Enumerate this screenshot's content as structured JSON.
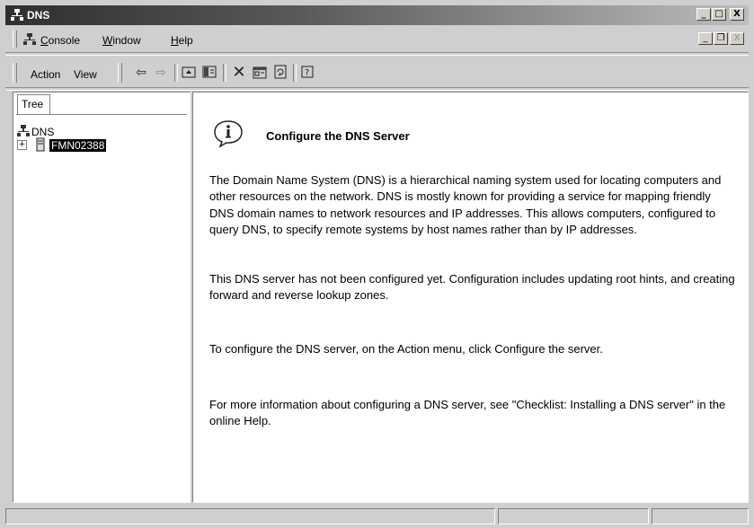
{
  "window": {
    "title": "DNS",
    "app_icon": "dns-tree-icon",
    "controls": {
      "minimize": "_",
      "maximize": "□",
      "close": "X"
    }
  },
  "menubar": {
    "items": [
      {
        "label": "Console",
        "underline": "C"
      },
      {
        "label": "Window",
        "underline": "W"
      },
      {
        "label": "Help",
        "underline": "H"
      }
    ],
    "mdi_controls": {
      "minimize": "_",
      "restore": "❐",
      "close": "X"
    }
  },
  "toolbar": {
    "action_label": "Action",
    "view_label": "View",
    "icons": [
      "back-arrow-icon",
      "forward-arrow-icon",
      "up-level-icon",
      "show-hide-tree-icon",
      "delete-icon",
      "properties-icon",
      "refresh-icon",
      "help-icon"
    ]
  },
  "tree": {
    "tab_label": "Tree",
    "root_label": "DNS",
    "server_label": "FMN02388",
    "expander": "+"
  },
  "content": {
    "title": "Configure the DNS Server",
    "paragraphs": [
      "The Domain Name System (DNS) is a hierarchical naming system used for locating computers and other resources on the network. DNS is mostly known for providing a service for mapping friendly DNS domain names to network resources and IP addresses. This allows computers, configured to query DNS, to specify remote systems by host names rather than by IP addresses.",
      "This DNS server has not been configured yet. Configuration includes updating root hints, and creating forward and reverse lookup zones.",
      "To configure the DNS server, on the Action menu, click Configure the server.",
      "For more information about configuring a DNS server, see \"Checklist: Installing a DNS server\" in the online Help."
    ]
  },
  "statusbar": {
    "cells": [
      "",
      "",
      ""
    ]
  },
  "colors": {
    "titlebar_start": "#2e2e2e",
    "titlebar_end": "#bdbdbd",
    "selection": "#000000"
  }
}
